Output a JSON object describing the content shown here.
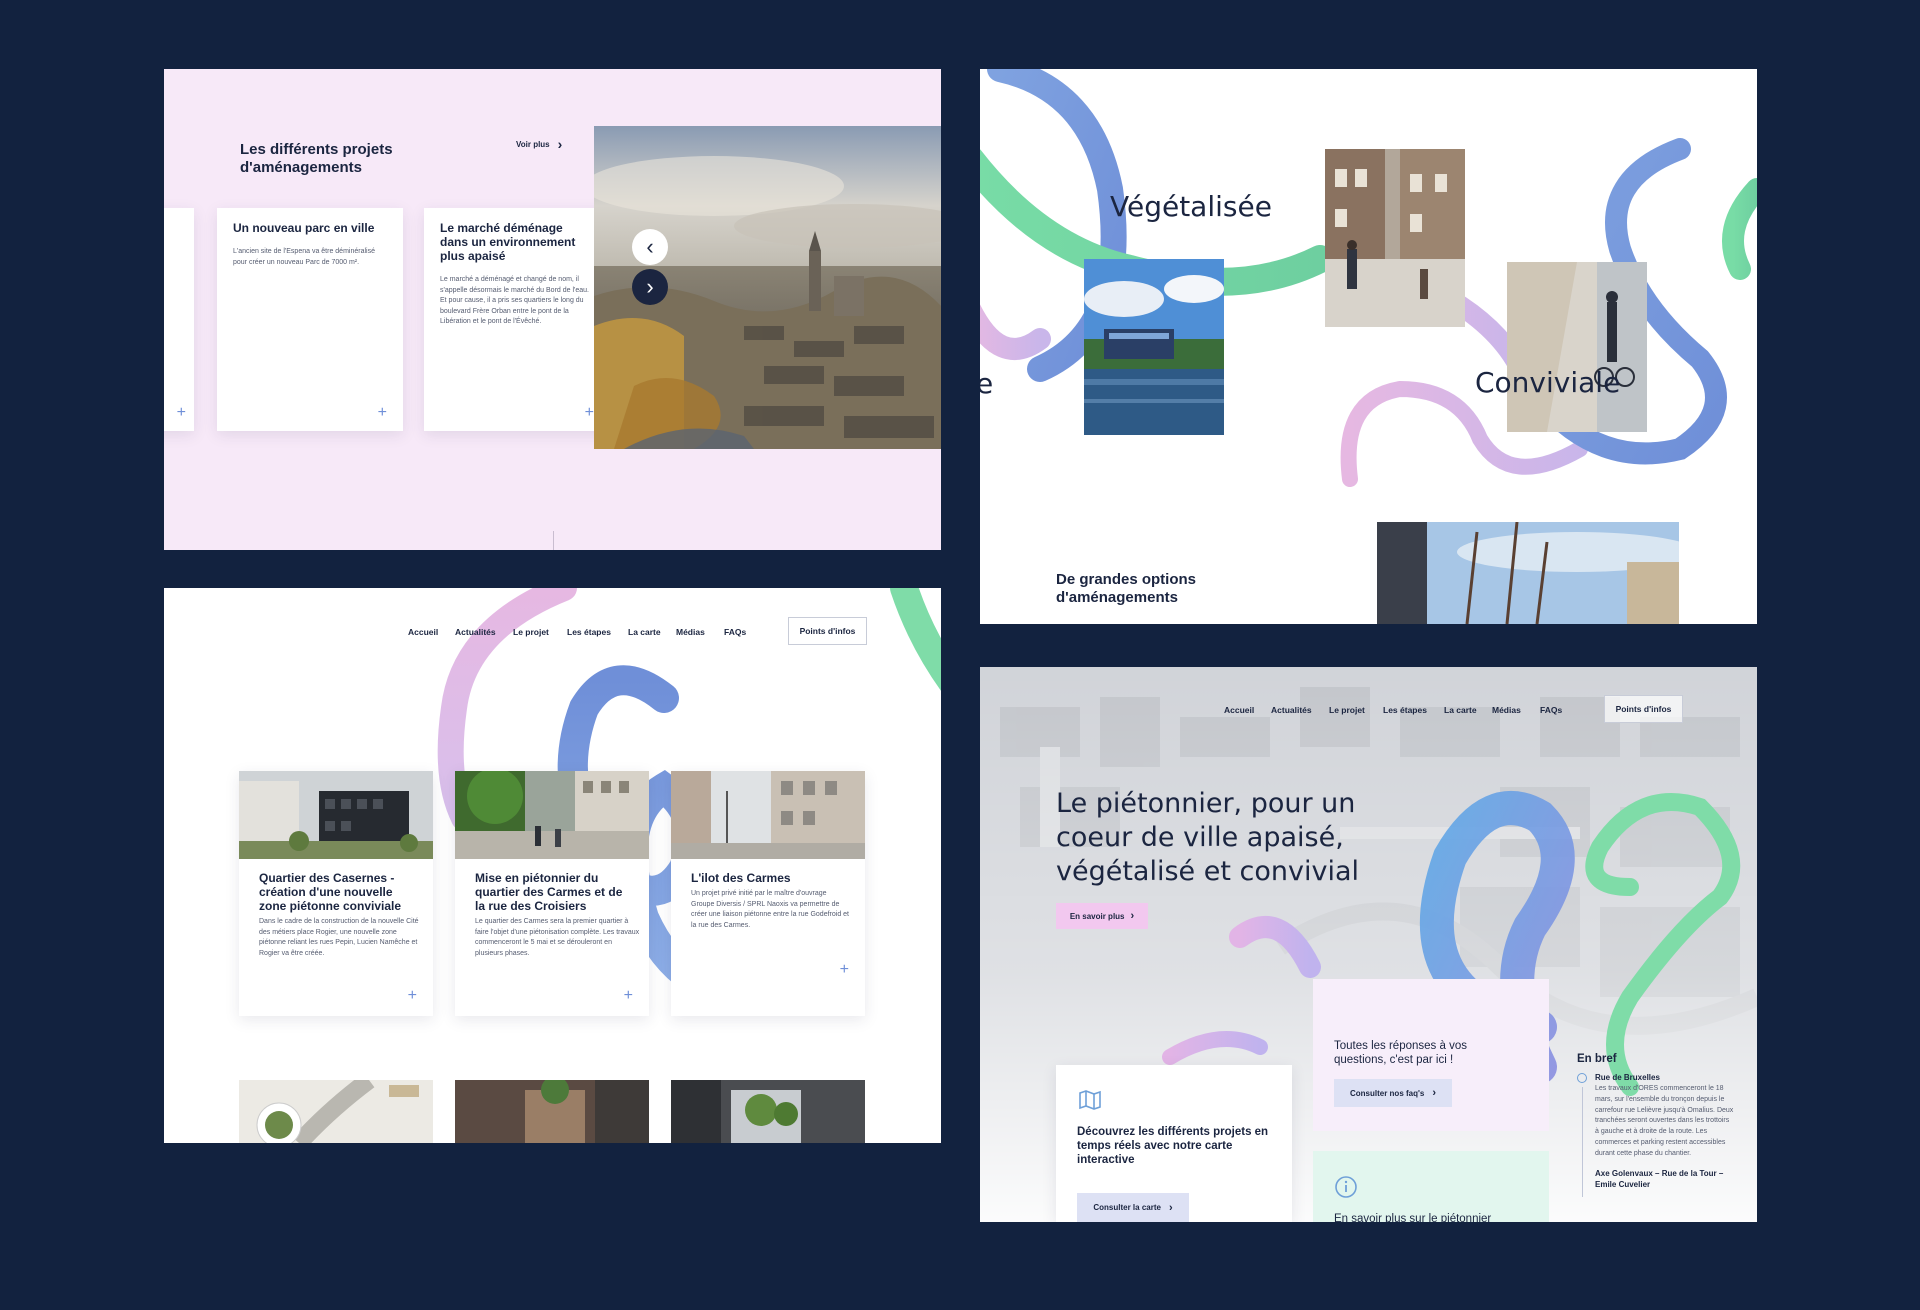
{
  "panel1": {
    "section_title": "Les différents projets d'aménagements",
    "see_more": "Voir plus",
    "cards": [
      {
        "title": "Un nouveau parc en ville",
        "text": "L'ancien site de l'Espena va être déminéralisé pour créer un nouveau Parc de 7000 m²."
      },
      {
        "title": "Le marché déménage dans un environnement plus apaisé",
        "text": "Le marché a déménagé et changé de nom, il s'appelle désormais le marché du Bord de l'eau. Et pour cause, il a pris ses quartiers le long du boulevard Frère Orban entre le pont de la Libération et le pont de l'Évêché."
      }
    ],
    "plus": "+",
    "prev_icon": "‹",
    "next_icon": "›"
  },
  "panel2": {
    "word_vegetalisee": "Végétalisée",
    "word_conviviale": "Conviviale",
    "word_partial": "e",
    "section_title": "De grandes options d'aménagements"
  },
  "panel3": {
    "nav": [
      "Accueil",
      "Actualités",
      "Le projet",
      "Les étapes",
      "La carte",
      "Médias",
      "FAQs"
    ],
    "nav_button": "Points d'infos",
    "cards": [
      {
        "title": "Quartier des Casernes - création d'une nouvelle zone piétonne conviviale",
        "text": "Dans le cadre de la construction de la nouvelle Cité des métiers place Rogier, une nouvelle zone piétonne reliant les rues Pepin, Lucien Namêche et Rogier va être créée."
      },
      {
        "title": "Mise en piétonnier du quartier des Carmes et de la rue des Croisiers",
        "text": "Le quartier des Carmes sera la premier quartier à faire l'objet d'une piétonisation complète. Les travaux commenceront le 5 mai et se dérouleront en plusieurs phases."
      },
      {
        "title": "L'ilot des Carmes",
        "text": "Un projet privé initié par le maître d'ouvrage Groupe Diversis / SPRL Naoxis va permettre de créer une liaison piétonne entre la rue Godefroid et la rue des Carmes."
      }
    ],
    "plus": "+"
  },
  "panel4": {
    "nav": [
      "Accueil",
      "Actualités",
      "Le projet",
      "Les étapes",
      "La carte",
      "Médias",
      "FAQs"
    ],
    "nav_button": "Points d'infos",
    "hero_title": "Le piétonnier, pour un coeur de ville apaisé, végétalisé et convivial",
    "hero_button": "En savoir plus",
    "faq_title": "Toutes les réponses à vos questions, c'est par ici !",
    "faq_button": "Consulter nos faq's",
    "map_title": "Découvrez les différents projets en temps réels avec notre carte interactive",
    "map_button": "Consulter la carte",
    "info_title": "En savoir plus sur le piétonnier",
    "brief_title": "En bref",
    "brief_items": [
      {
        "title": "Rue de Bruxelles",
        "text": "Les travaux d'ORES commenceront le 18 mars, sur l'ensemble du tronçon depuis le carrefour rue Lelièvre jusqu'à Omalius. Deux tranchées seront ouvertes dans les trottoirs à gauche et à droite de la route. Les commerces et parking restent accessibles durant cette phase du chantier."
      },
      {
        "title": "Axe Golenvaux – Rue de la Tour – Emile Cuvelier",
        "text": ""
      }
    ],
    "chevron": "›"
  },
  "colors": {
    "background": "#12223f",
    "pink_panel": "#f7e9f8",
    "navy": "#1b2540",
    "accent_blue": "#6f8fd8",
    "pink_button": "#f2c8ef",
    "mint": "#7fdca8"
  }
}
